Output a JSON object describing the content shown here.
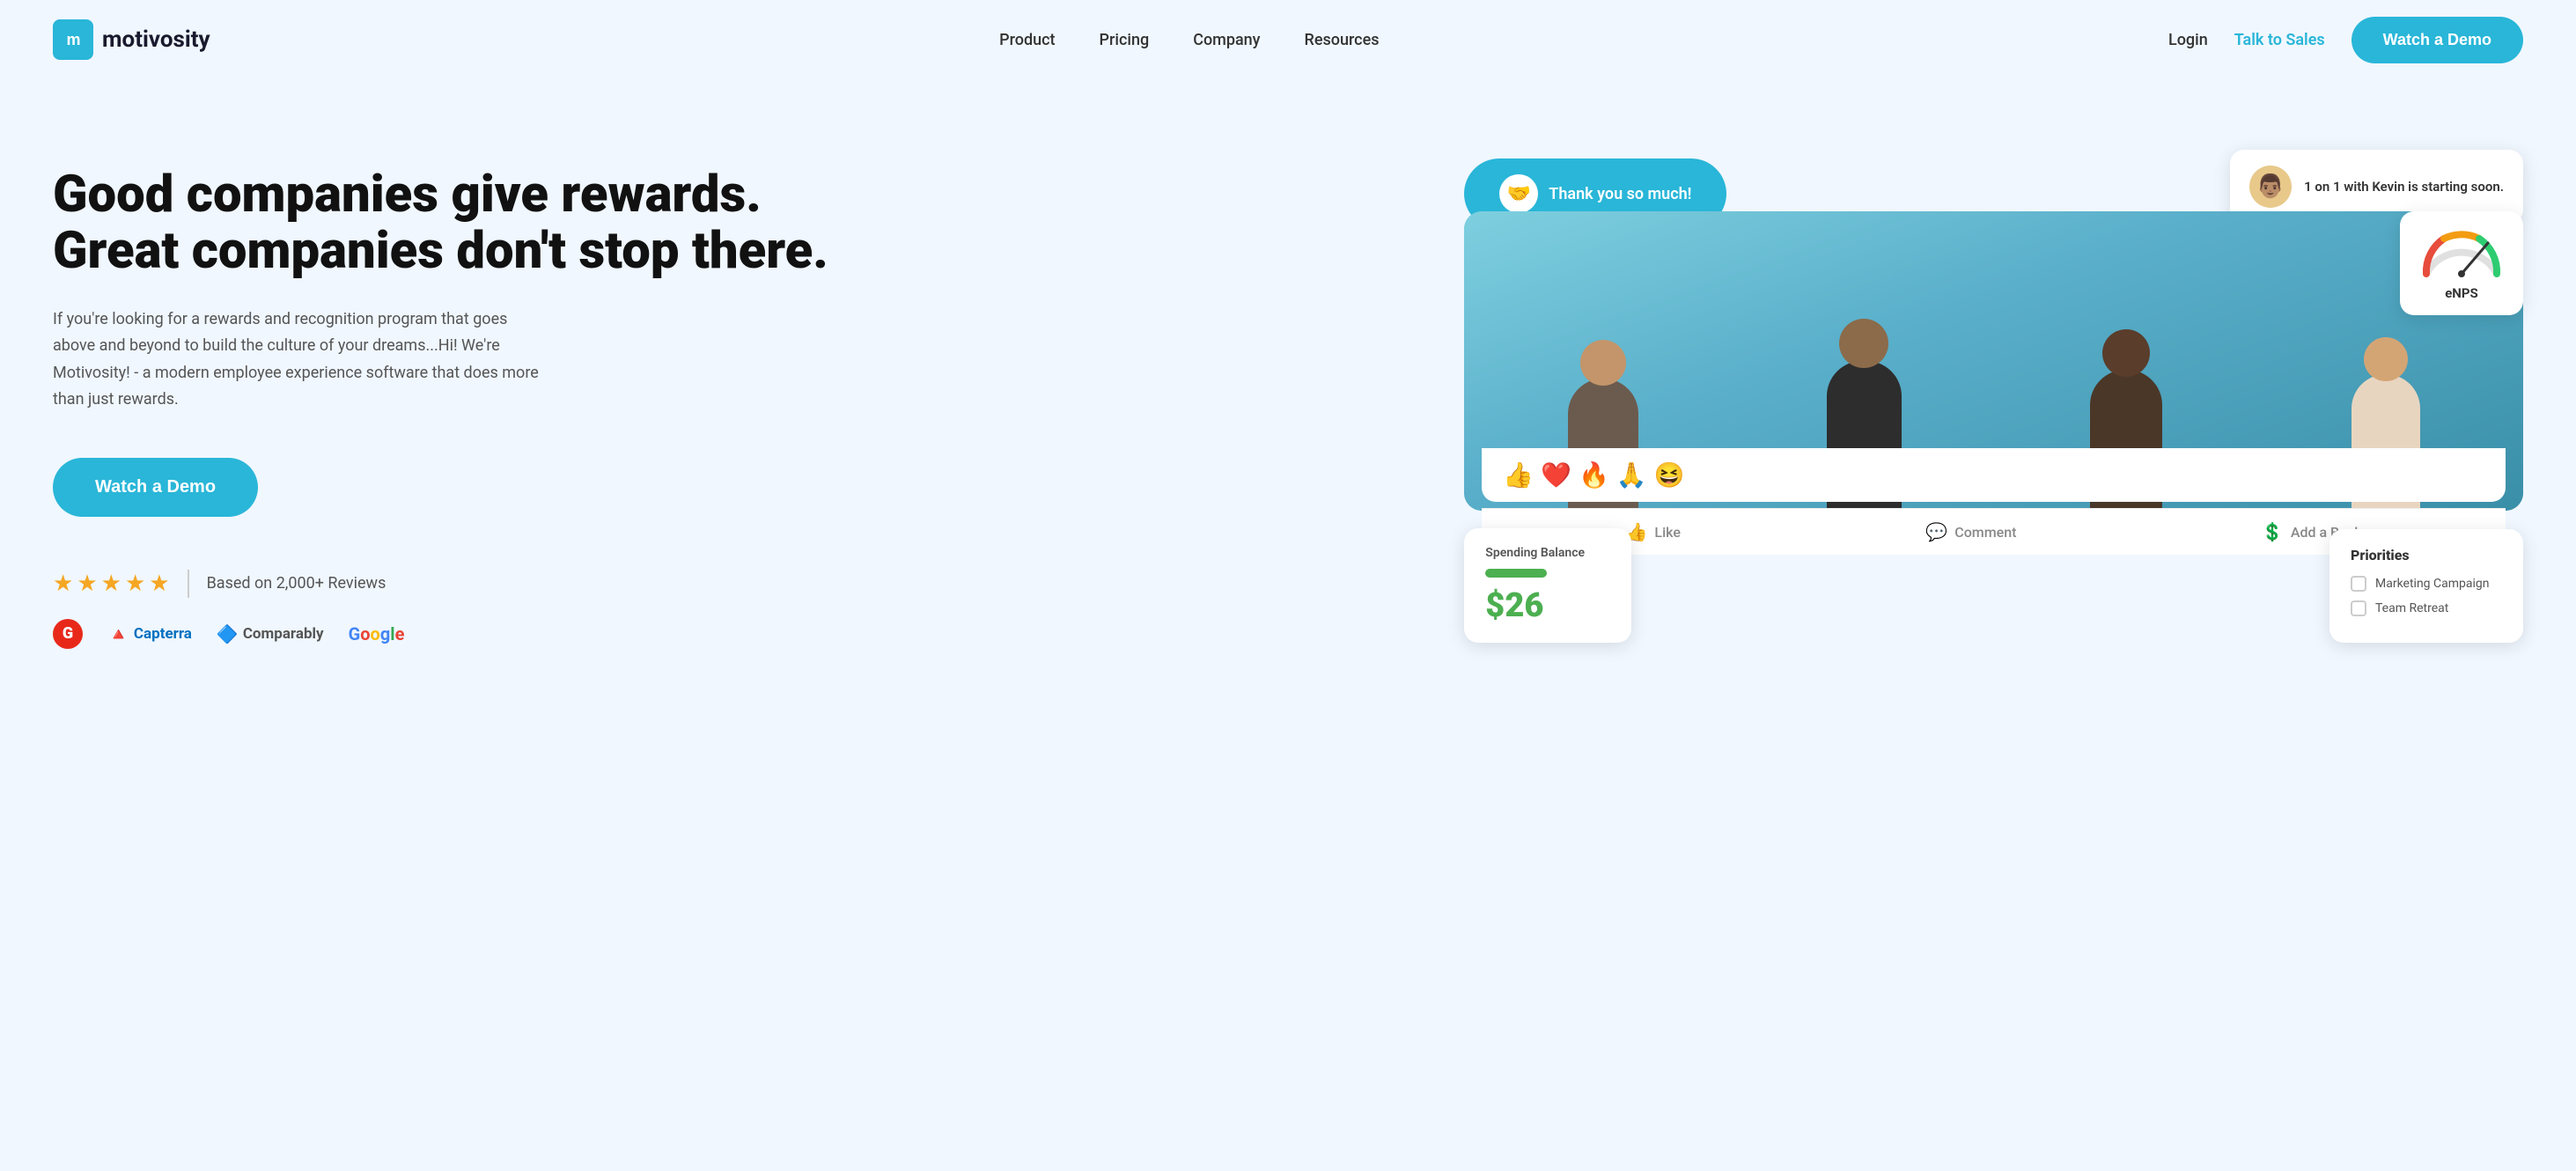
{
  "logo": {
    "icon_text": "m",
    "brand_name": "motivosity"
  },
  "nav": {
    "links": [
      {
        "id": "product",
        "label": "Product"
      },
      {
        "id": "pricing",
        "label": "Pricing"
      },
      {
        "id": "company",
        "label": "Company"
      },
      {
        "id": "resources",
        "label": "Resources"
      }
    ],
    "login": "Login",
    "talk_to_sales": "Talk to Sales",
    "watch_demo": "Watch a Demo"
  },
  "hero": {
    "title_line1": "Good companies give rewards.",
    "title_line2": "Great companies don't stop there.",
    "subtitle": "If you're looking for a rewards and recognition program that goes above and beyond to build the culture of your dreams...Hi! We're Motivosity! - a modern employee experience software that does more than just rewards.",
    "cta_label": "Watch a Demo",
    "reviews_text": "Based on 2,000+ Reviews",
    "stars_count": 5
  },
  "brands": [
    {
      "id": "g2",
      "label": "G2"
    },
    {
      "id": "capterra",
      "label": "Capterra"
    },
    {
      "id": "comparably",
      "label": "Comparably"
    },
    {
      "id": "google",
      "label": "Google"
    }
  ],
  "mockup": {
    "thankyou_text": "Thank you so much!",
    "meeting_text": "1 on 1 with Kevin is starting soon.",
    "reaction_emojis": [
      "👍",
      "❤️",
      "🔥",
      "🙏",
      "😆"
    ],
    "actions": [
      {
        "icon": "👍",
        "label": "Like"
      },
      {
        "icon": "💬",
        "label": "Comment"
      },
      {
        "icon": "💲",
        "label": "Add a Buck"
      }
    ],
    "spending_label": "Spending Balance",
    "spending_amount": "$26",
    "priorities_title": "Priorities",
    "priorities_items": [
      "Marketing Campaign",
      "Team Retreat"
    ],
    "enps_label": "eNPS"
  },
  "colors": {
    "primary": "#29b6d8",
    "accent_green": "#4CAF50",
    "accent_yellow": "#f5a623"
  }
}
